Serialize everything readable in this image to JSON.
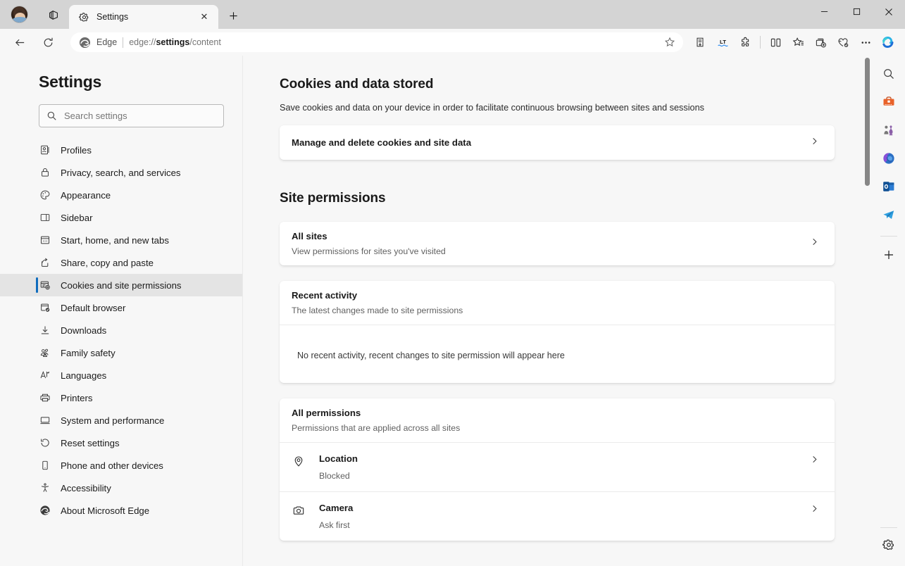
{
  "window": {
    "controls": {
      "minimize": "─",
      "maximize": "□",
      "close": "✕"
    }
  },
  "titlebar": {
    "profile_icon": "avatar",
    "tab_list_icon": "tab-list-icon",
    "tabs": [
      {
        "title": "Settings",
        "icon": "gear-icon",
        "close_label": "✕",
        "active": true
      }
    ],
    "new_tab_label": "+"
  },
  "toolbar": {
    "back_label": "←",
    "refresh_label": "⟳",
    "omnibox": {
      "brand": "Edge",
      "url_prefix": "edge://",
      "url_bold": "settings",
      "url_suffix": "/content",
      "favorite_icon": "star-icon"
    },
    "icons": [
      {
        "name": "collections-split-icon",
        "glyph": "split"
      },
      {
        "name": "immersive-reader-icon",
        "glyph": "LT"
      },
      {
        "name": "extensions-icon",
        "glyph": "puzzle"
      },
      {
        "name": "split-screen-icon",
        "glyph": "splitscreen"
      },
      {
        "name": "favorites-icon",
        "glyph": "starlist"
      },
      {
        "name": "collections-icon",
        "glyph": "collections"
      },
      {
        "name": "browser-essentials-icon",
        "glyph": "heart"
      },
      {
        "name": "settings-and-more-icon",
        "glyph": "⋯"
      },
      {
        "name": "copilot-icon",
        "glyph": "copilot"
      }
    ]
  },
  "sidebar": {
    "title": "Settings",
    "search": {
      "placeholder": "Search settings",
      "value": "",
      "icon": "search-icon"
    },
    "items": [
      {
        "label": "Profiles",
        "icon": "profiles-icon",
        "selected": false
      },
      {
        "label": "Privacy, search, and services",
        "icon": "lock-icon",
        "selected": false
      },
      {
        "label": "Appearance",
        "icon": "palette-icon",
        "selected": false
      },
      {
        "label": "Sidebar",
        "icon": "sidebar-icon",
        "selected": false
      },
      {
        "label": "Start, home, and new tabs",
        "icon": "home-icon",
        "selected": false
      },
      {
        "label": "Share, copy and paste",
        "icon": "share-icon",
        "selected": false
      },
      {
        "label": "Cookies and site permissions",
        "icon": "cookies-icon",
        "selected": true
      },
      {
        "label": "Default browser",
        "icon": "default-browser-icon",
        "selected": false
      },
      {
        "label": "Downloads",
        "icon": "download-icon",
        "selected": false
      },
      {
        "label": "Family safety",
        "icon": "family-icon",
        "selected": false
      },
      {
        "label": "Languages",
        "icon": "languages-icon",
        "selected": false
      },
      {
        "label": "Printers",
        "icon": "printer-icon",
        "selected": false
      },
      {
        "label": "System and performance",
        "icon": "monitor-icon",
        "selected": false
      },
      {
        "label": "Reset settings",
        "icon": "reset-icon",
        "selected": false
      },
      {
        "label": "Phone and other devices",
        "icon": "phone-icon",
        "selected": false
      },
      {
        "label": "Accessibility",
        "icon": "accessibility-icon",
        "selected": false
      },
      {
        "label": "About Microsoft Edge",
        "icon": "edge-icon",
        "selected": false
      }
    ]
  },
  "main": {
    "cookies_section": {
      "title": "Cookies and data stored",
      "description": "Save cookies and data on your device in order to facilitate continuous browsing between sites and sessions",
      "manage_row": {
        "title": "Manage and delete cookies and site data",
        "chevron": "›"
      }
    },
    "permissions_section": {
      "title": "Site permissions",
      "all_sites": {
        "title": "All sites",
        "subtitle": "View permissions for sites you've visited",
        "chevron": "›"
      },
      "recent_activity": {
        "title": "Recent activity",
        "subtitle": "The latest changes made to site permissions",
        "empty_message": "No recent activity, recent changes to site permission will appear here"
      },
      "all_permissions": {
        "title": "All permissions",
        "subtitle": "Permissions that are applied across all sites",
        "entries": [
          {
            "label": "Location",
            "state": "Blocked",
            "icon": "location-icon",
            "chevron": "›"
          },
          {
            "label": "Camera",
            "state": "Ask first",
            "icon": "camera-icon",
            "chevron": "›"
          }
        ]
      }
    }
  },
  "rail": {
    "items": [
      {
        "name": "search-icon"
      },
      {
        "name": "shopping-icon"
      },
      {
        "name": "games-icon"
      },
      {
        "name": "microsoft-365-icon"
      },
      {
        "name": "outlook-icon"
      },
      {
        "name": "telegram-icon"
      }
    ],
    "add_label": "+",
    "settings_icon": "gear-icon"
  },
  "colors": {
    "accent": "#0f6cbd",
    "titlebar_bg": "#d4d4d4",
    "chrome_bg": "#f7f7f7",
    "card_bg": "#ffffff",
    "selected_bg": "#e4e4e4"
  }
}
